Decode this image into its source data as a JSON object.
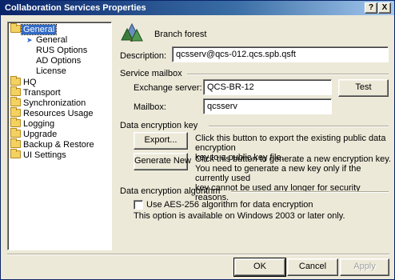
{
  "window": {
    "title": "Collaboration Services Properties",
    "help_button": "?",
    "close_button": "X"
  },
  "tree": {
    "items": [
      {
        "label": "General",
        "selected": true,
        "icon": "folder-icon"
      },
      {
        "label": "General",
        "current": true,
        "icon": "arrow-icon"
      },
      {
        "label": "RUS Options"
      },
      {
        "label": "AD Options"
      },
      {
        "label": "License"
      },
      {
        "label": "HQ",
        "icon": "folder-icon"
      },
      {
        "label": "Transport",
        "icon": "folder-icon"
      },
      {
        "label": "Synchronization",
        "icon": "folder-icon"
      },
      {
        "label": "Resources Usage",
        "icon": "folder-icon"
      },
      {
        "label": "Logging",
        "icon": "folder-icon"
      },
      {
        "label": "Upgrade",
        "icon": "folder-icon"
      },
      {
        "label": "Backup & Restore",
        "icon": "folder-icon"
      },
      {
        "label": "UI Settings",
        "icon": "folder-icon"
      }
    ]
  },
  "header": {
    "icon": "forest-icon",
    "object_name": "Branch forest"
  },
  "description": {
    "label": "Description:",
    "value": "qcsserv@qcs-012.qcs.spb.qsft"
  },
  "service_mailbox": {
    "heading": "Service mailbox",
    "exchange_label": "Exchange server:",
    "exchange_value": "QCS-BR-12",
    "test_button": "Test",
    "mailbox_label": "Mailbox:",
    "mailbox_value": "qcsserv"
  },
  "encryption_key": {
    "heading": "Data encryption key",
    "export_button": "Export...",
    "export_desc_1": "Click this button to export the existing public data encryption",
    "export_desc_2": "key to a public key file.",
    "generate_button": "Generate New",
    "generate_desc_1": "Click this button to generate a new encryption key.",
    "generate_desc_2": "You need to generate a new key only if the currently used",
    "generate_desc_3": "key cannot be used any longer for security reasons."
  },
  "encryption_algorithm": {
    "heading": "Data encryption algorithm",
    "aes_checkbox_label": "Use AES-256 algorithm for data encryption",
    "aes_checked": false,
    "note": "This option is available on Windows 2003 or later only."
  },
  "footer": {
    "ok": "OK",
    "cancel": "Cancel",
    "apply": "Apply"
  },
  "colors": {
    "title_bar": "#0a246a",
    "selection": "#316ac5",
    "dialog_bg": "#ece9d8"
  }
}
